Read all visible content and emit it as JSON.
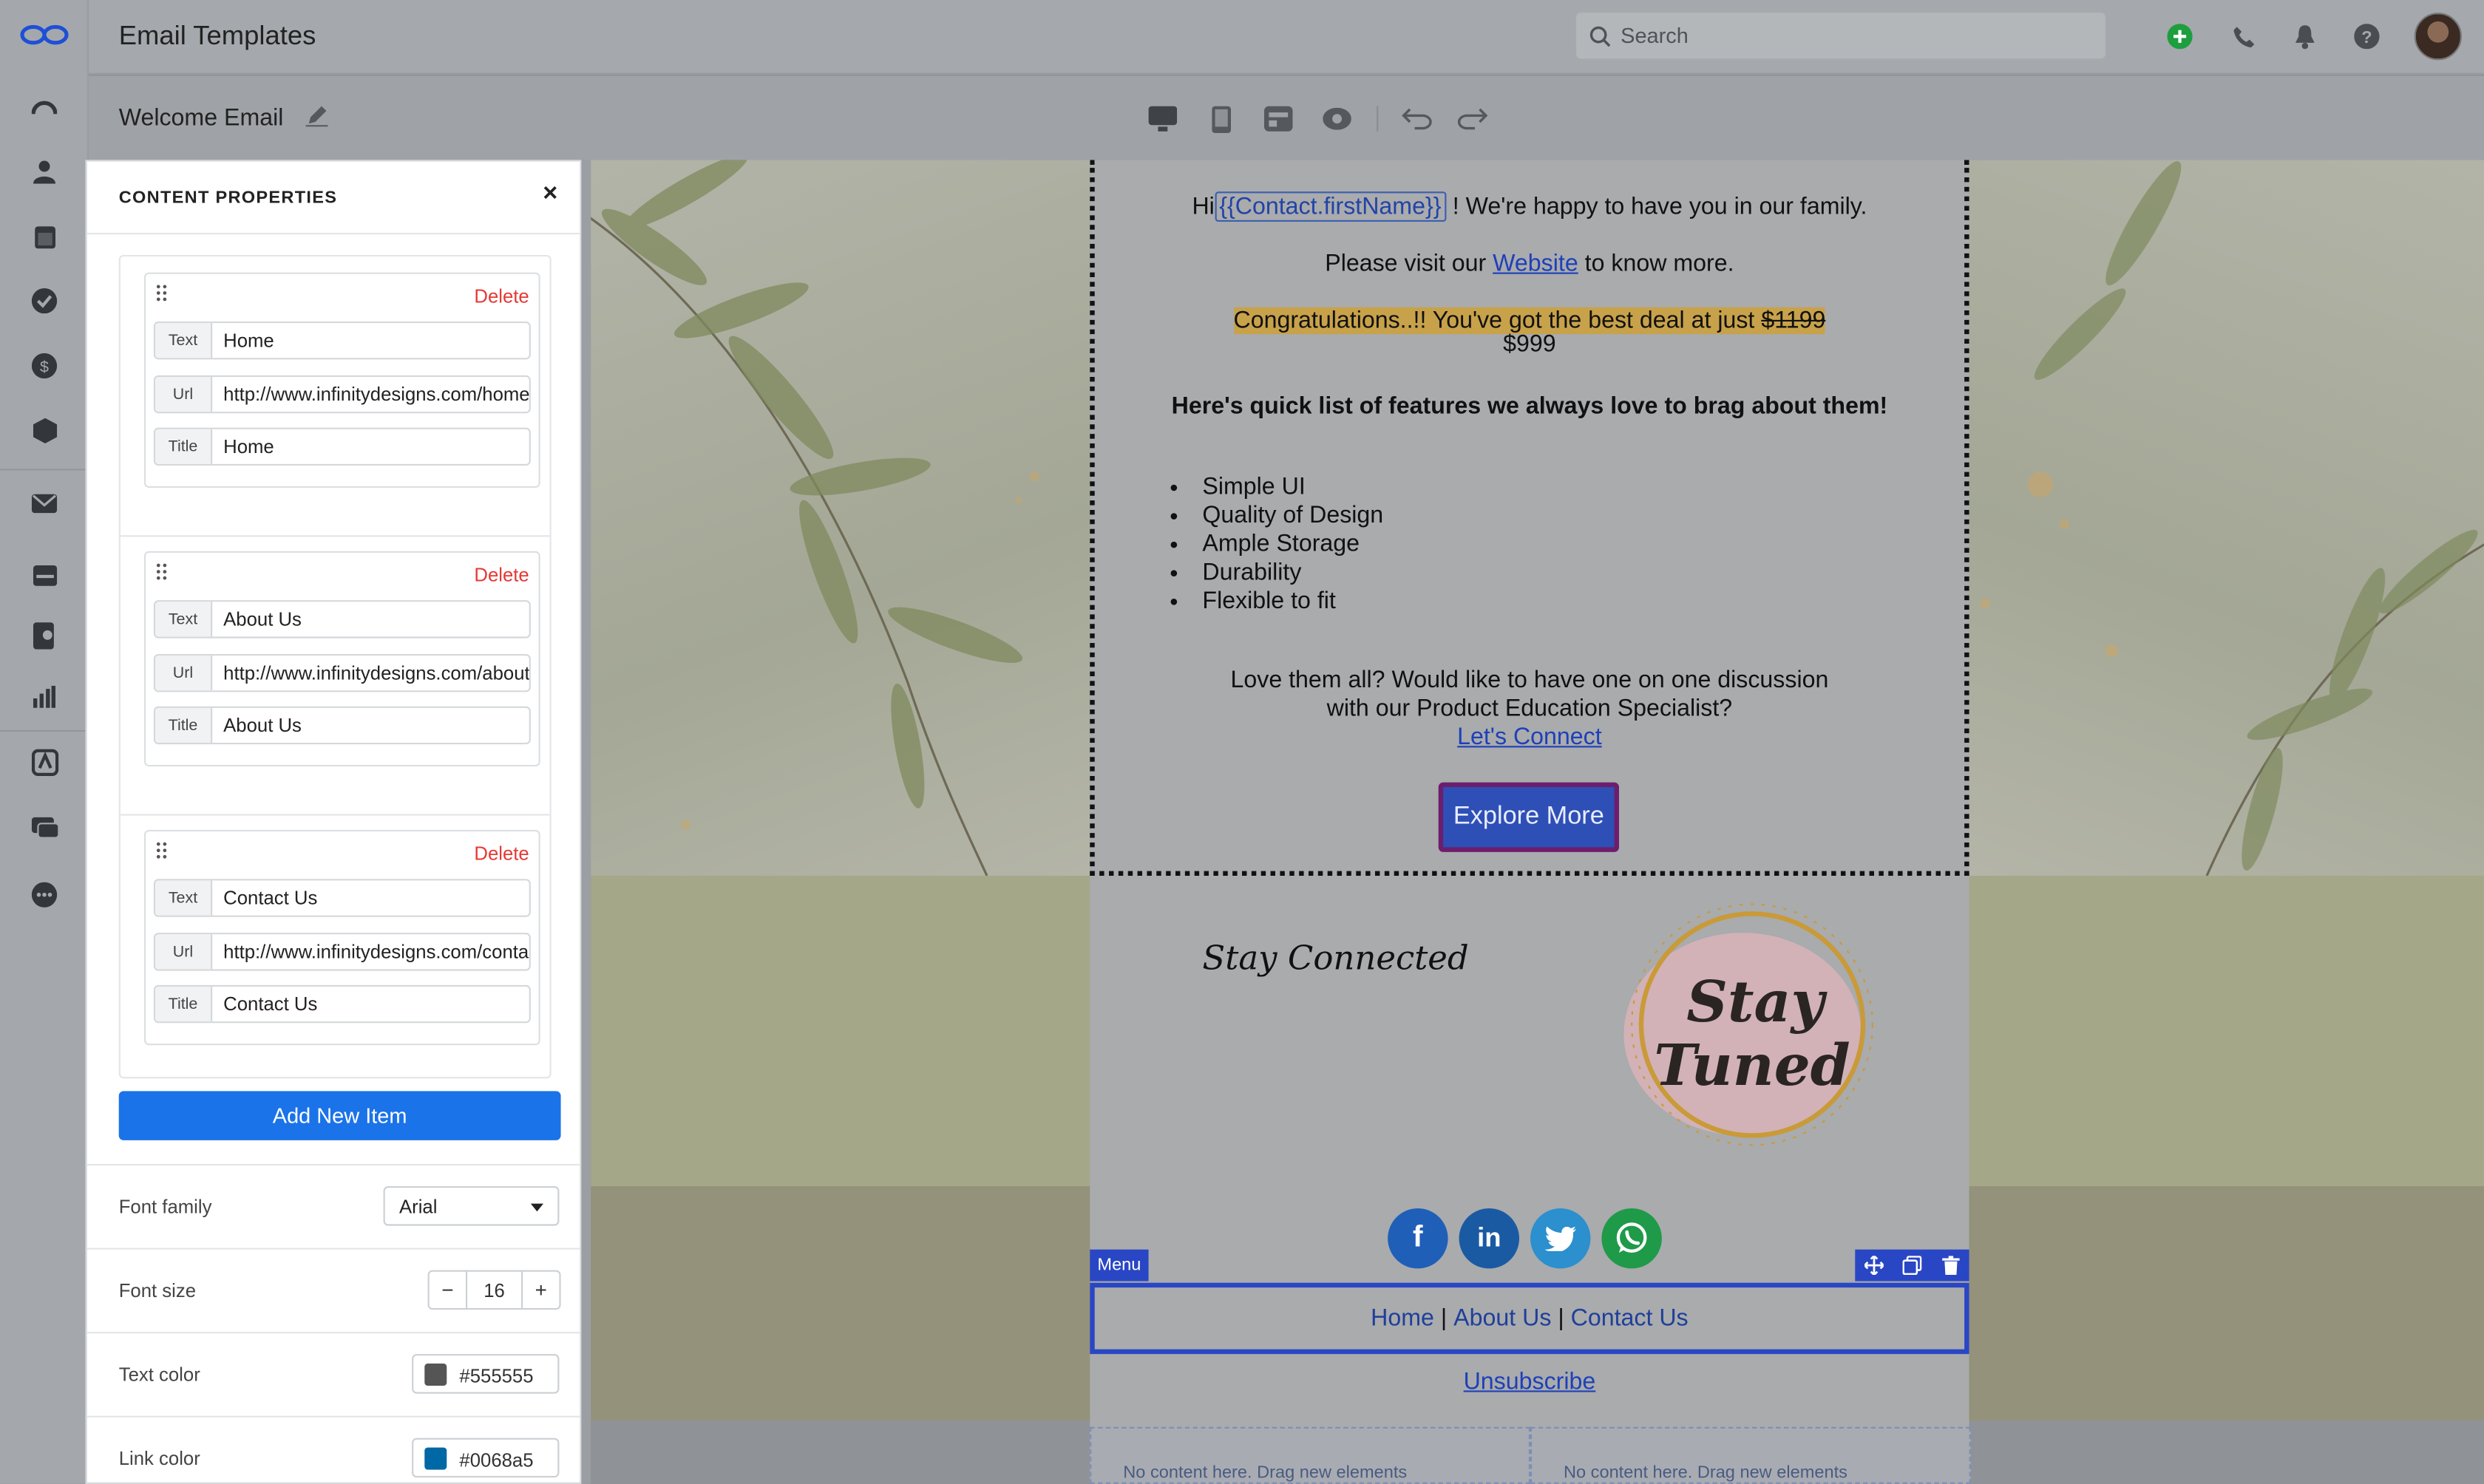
{
  "app": {
    "title": "Email Templates"
  },
  "search": {
    "placeholder": "Search"
  },
  "template": {
    "name": "Welcome Email"
  },
  "panel": {
    "title": "CONTENT PROPERTIES",
    "close": "×",
    "delete_label": "Delete",
    "field_labels": {
      "text": "Text",
      "url": "Url",
      "title": "Title"
    },
    "items": [
      {
        "text": "Home",
        "url": "http://www.infinitydesigns.com/home",
        "title": "Home"
      },
      {
        "text": "About Us",
        "url": "http://www.infinitydesigns.com/about",
        "title": "About Us"
      },
      {
        "text": "Contact Us",
        "url": "http://www.infinitydesigns.com/contact",
        "title": "Contact Us"
      }
    ],
    "add_button": "Add New Item",
    "font_family": {
      "label": "Font family",
      "value": "Arial"
    },
    "font_size": {
      "label": "Font size",
      "value": "16",
      "minus": "−",
      "plus": "+"
    },
    "text_color": {
      "label": "Text color",
      "value": "#555555"
    },
    "link_color": {
      "label": "Link color",
      "value": "#0068a5"
    }
  },
  "email": {
    "greeting_pre": "Hi",
    "merge_tag": "{{Contact.firstName}}",
    "greeting_post": "! We're happy to have you in our family.",
    "visit_pre": "Please visit our",
    "visit_link": "Website",
    "visit_post": "to know more.",
    "deal_text": "Congratulations..!! You've got the best deal at just",
    "old_price": "$1199",
    "new_price": "$999",
    "features_heading": "Here's quick list of features we always love to brag about them!",
    "features": [
      "Simple UI",
      "Quality of Design",
      "Ample Storage",
      "Durability",
      "Flexible to fit"
    ],
    "discussion_line1": "Love them all? Would like to have one on one discussion",
    "discussion_line2": "with our Product Education Specialist?",
    "connect_link": "Let's Connect",
    "cta": "Explore More",
    "stay_connected": "Stay Connected",
    "badge_line1": "Stay",
    "badge_line2": "Tuned",
    "socials": [
      {
        "name": "facebook",
        "glyph": "f",
        "color": "#1877f2"
      },
      {
        "name": "linkedin",
        "glyph": "in",
        "color": "#0a66c2"
      },
      {
        "name": "twitter",
        "glyph": "t",
        "color": "#1da1f2"
      },
      {
        "name": "whatsapp",
        "glyph": "w",
        "color": "#25d366"
      }
    ],
    "menu_tag": "Menu",
    "menu": [
      "Home",
      "About Us",
      "Contact Us"
    ],
    "menu_sep": "|",
    "unsubscribe": "Unsubscribe",
    "empty_placeholder": "No content here. Drag new elements"
  }
}
